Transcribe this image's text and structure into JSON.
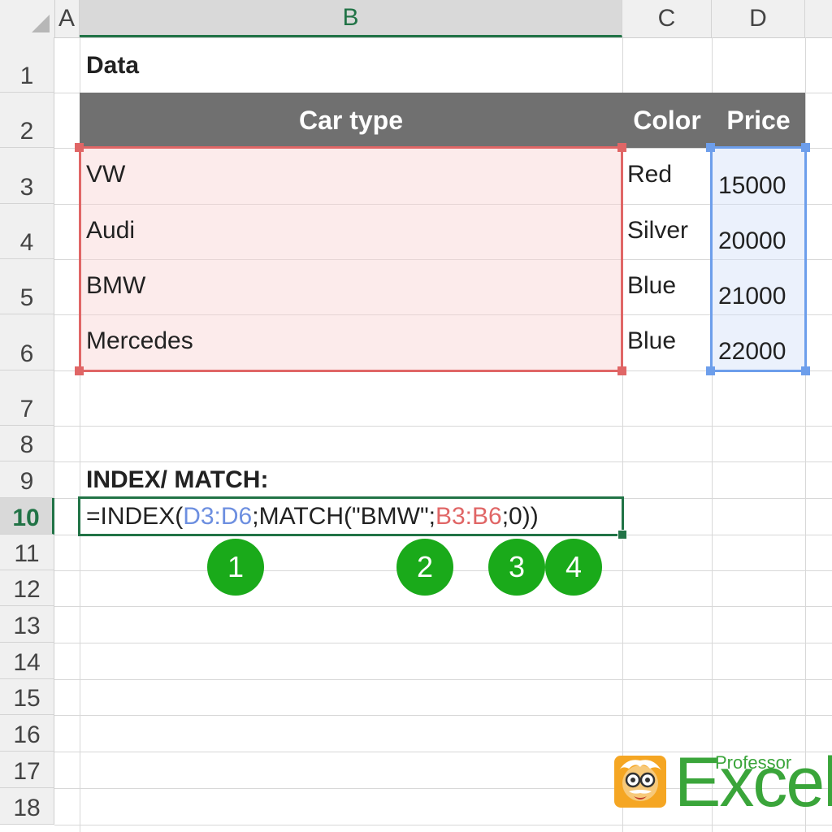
{
  "columns": [
    "A",
    "B",
    "C",
    "D"
  ],
  "rows": [
    "1",
    "2",
    "3",
    "4",
    "5",
    "6",
    "7",
    "8",
    "9",
    "10",
    "11",
    "12",
    "13",
    "14",
    "15",
    "16",
    "17",
    "18"
  ],
  "cells": {
    "b1": "Data",
    "b9": "INDEX/ MATCH:"
  },
  "table": {
    "headers": [
      "Car type",
      "Color",
      "Price"
    ],
    "rows": [
      [
        "VW",
        "Red",
        "15000"
      ],
      [
        "Audi",
        "Silver",
        "20000"
      ],
      [
        "BMW",
        "Blue",
        "21000"
      ],
      [
        "Mercedes",
        "Blue",
        "22000"
      ]
    ]
  },
  "formula": {
    "p1": "=INDEX(",
    "ref1": "D3:D6",
    "p2": ";MATCH(\"BMW\";",
    "ref2": "B3:B6",
    "p3": ";0))"
  },
  "badges": [
    "1",
    "2",
    "3",
    "4"
  ],
  "logo": {
    "top": "Professor",
    "word": "Excel"
  },
  "colors": {
    "excel_green": "#217346",
    "badge_green": "#1aaa1a",
    "ref_red": "#e06666",
    "ref_blue": "#6d9eeb",
    "header_gray": "#707070"
  }
}
